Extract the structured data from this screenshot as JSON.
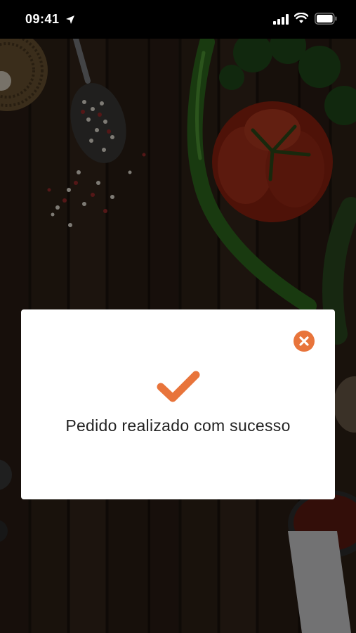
{
  "status_bar": {
    "time": "09:41",
    "icons": [
      "location-arrow-icon",
      "signal-icon",
      "wifi-icon",
      "battery-icon"
    ]
  },
  "background": {
    "description_icon": "food-photo"
  },
  "modal": {
    "close_icon": "close-icon",
    "success_icon": "checkmark-icon",
    "message": "Pedido realizado com sucesso"
  },
  "colors": {
    "accent": "#e8743b",
    "modal_bg": "#ffffff",
    "text": "#222222"
  }
}
